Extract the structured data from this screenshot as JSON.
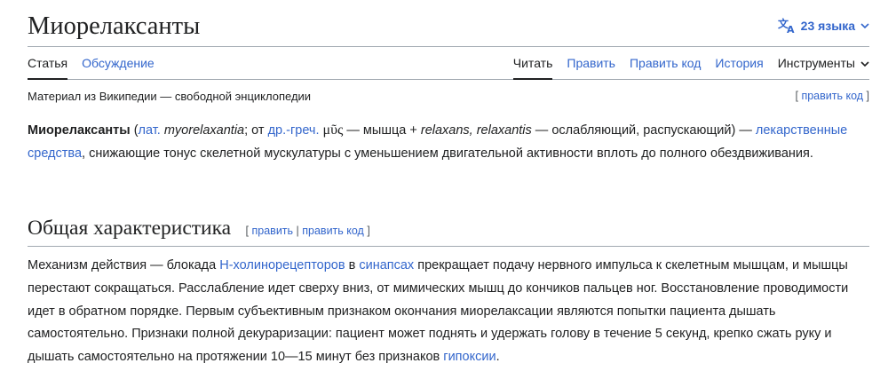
{
  "header": {
    "title": "Миорелаксанты",
    "languages_label": "23 языка",
    "icons": {
      "language": "translate-icon",
      "dropdown": "chevron-down-icon"
    }
  },
  "tabs": {
    "article": "Статья",
    "talk": "Обсуждение",
    "read": "Читать",
    "edit": "Править",
    "edit_source": "Править код",
    "history": "История",
    "tools": "Инструменты"
  },
  "tagline": "Материал из Википедии — свободной энциклопедии",
  "edit_top": {
    "open": "[ ",
    "label": "править код",
    "close": " ]"
  },
  "lead": {
    "term": "Миорелаксанты",
    "p1": " (",
    "lat_link": "лат.",
    "p2": " ",
    "latin": "myorelaxantia",
    "p3": "; от ",
    "greek_link": "др.-греч.",
    "p4": " ",
    "greek": "μῦς",
    "p5": " — мышца + ",
    "relaxans": "relaxans, relaxantis",
    "p6": " — ослабляющий, распускающий) — ",
    "drugs_link": "лекарственные средства",
    "p7": ", снижающие тонус скелетной мускулатуры с уменьшением двигательной активности вплоть до полного обездвиживания."
  },
  "section": {
    "title": "Общая характеристика",
    "open": "[ ",
    "edit": "править",
    "divider": " | ",
    "edit_source": "править код",
    "close": " ]"
  },
  "body": {
    "s1": "Механизм действия — блокада ",
    "receptors_link": "Н-холинорецепторов",
    "s2": " в ",
    "synapses_link": "синапсах",
    "s3": " прекращает подачу нервного импульса к скелетным мышцам, и мышцы перестают сокращаться. Расслабление идет сверху вниз, от мимических мышц до кончиков пальцев ног. Восстановление проводимости идет в обратном порядке. Первым субъективным признаком окончания миорелаксации являются попытки пациента дышать самостоятельно. Признаки полной декураризации: пациент может поднять и удержать голову в течение 5 секунд, крепко сжать руку и дышать самостоятельно на протяжении 10—15 минут без признаков ",
    "hypoxia_link": "гипоксии",
    "s4": "."
  }
}
